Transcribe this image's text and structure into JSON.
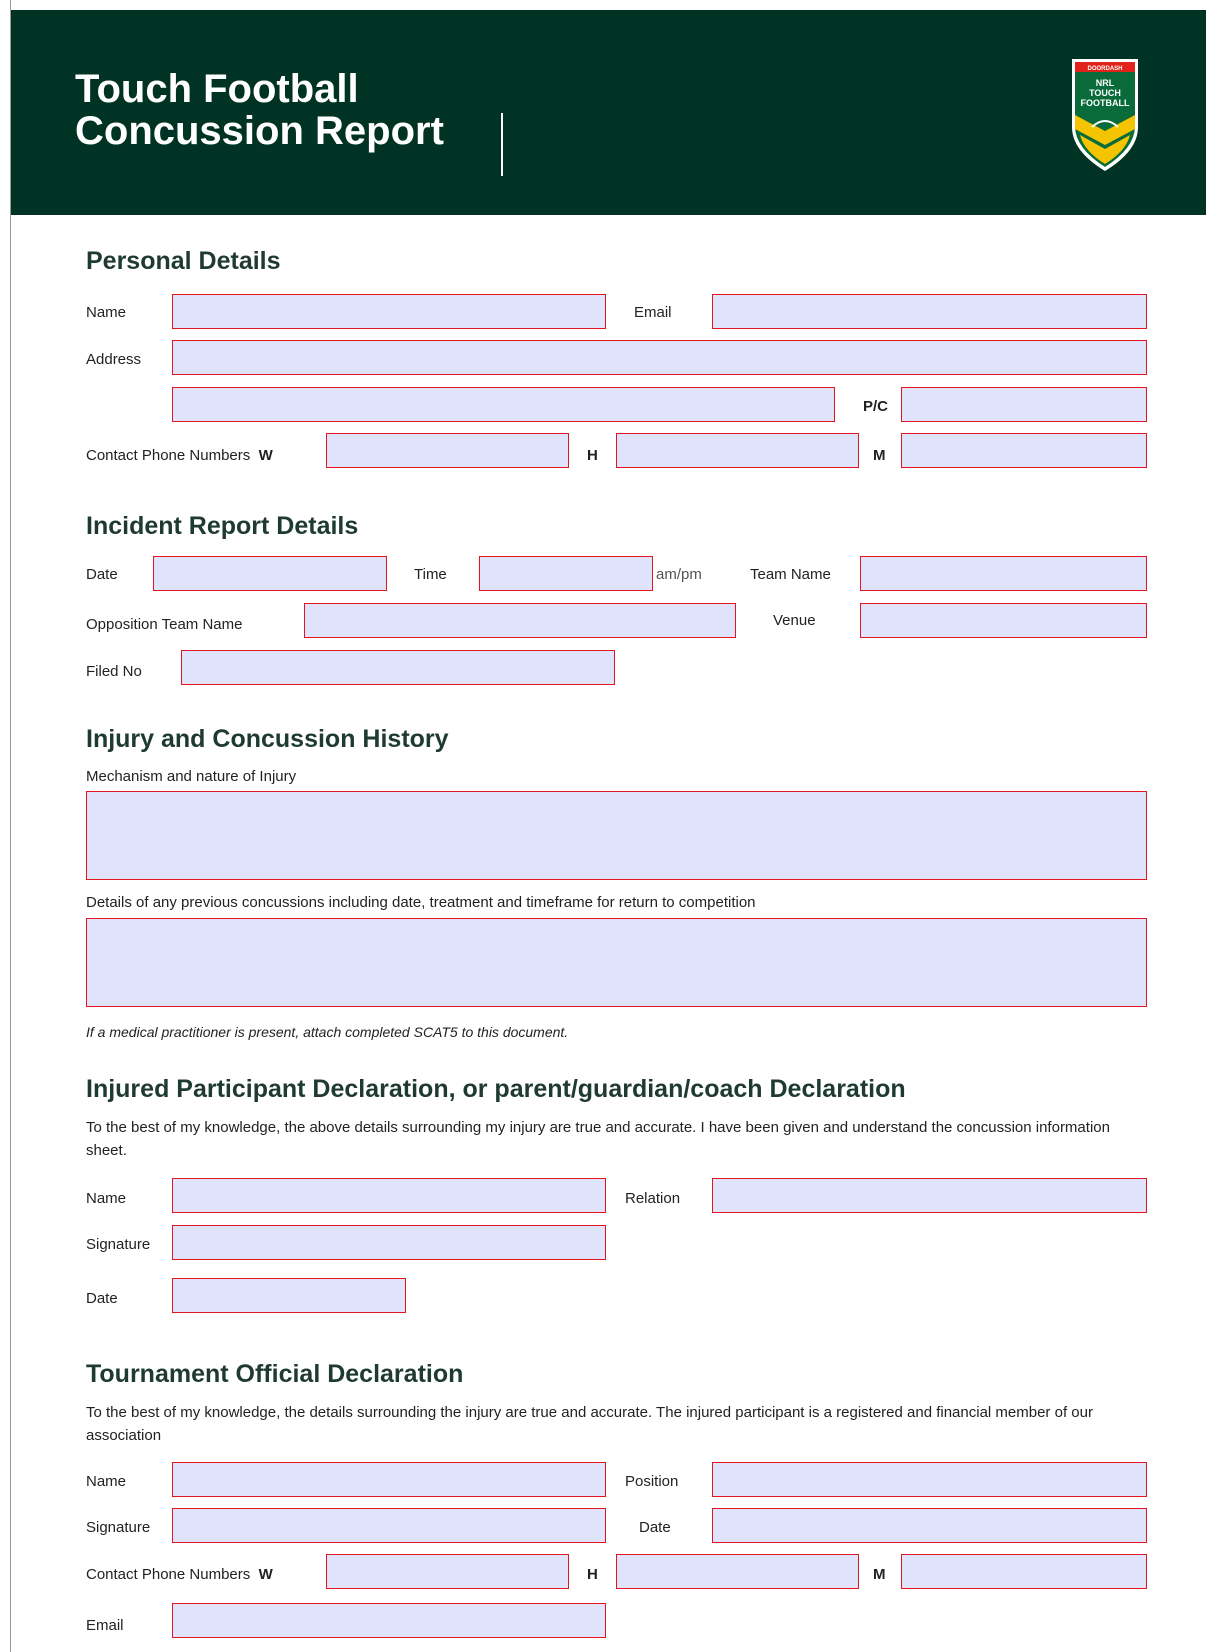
{
  "header": {
    "title_line1": "Touch Football",
    "title_line2": "Concussion Report",
    "logo": {
      "icon": "nrl-touch-football-shield-logo",
      "top_text": "DOORDASH",
      "line1": "NRL",
      "line2": "TOUCH",
      "line3": "FOOTBALL"
    }
  },
  "personal": {
    "heading": "Personal Details",
    "name_label": "Name",
    "email_label": "Email",
    "address_label": "Address",
    "pc_label": "P/C",
    "phone_label": "Contact Phone Numbers",
    "w_label": "W",
    "h_label": "H",
    "m_label": "M",
    "values": {
      "name": "",
      "email": "",
      "address1": "",
      "address2": "",
      "pc": "",
      "phone_w": "",
      "phone_h": "",
      "phone_m": ""
    }
  },
  "incident": {
    "heading": "Incident Report Details",
    "date_label": "Date",
    "time_label": "Time",
    "ampm_label": "am/pm",
    "team_label": "Team Name",
    "opposition_label": "Opposition Team Name",
    "venue_label": "Venue",
    "filed_label": "Filed No",
    "values": {
      "date": "",
      "time": "",
      "team": "",
      "opposition": "",
      "venue": "",
      "filed_no": ""
    }
  },
  "history": {
    "heading": "Injury and Concussion History",
    "mechanism_label": "Mechanism and nature of Injury",
    "previous_label": "Details of any previous concussions including date, treatment and timeframe for return to competition",
    "note": "If a medical practitioner is present, attach completed SCAT5 to this document.",
    "values": {
      "mechanism": "",
      "previous": ""
    }
  },
  "participant": {
    "heading": "Injured Participant Declaration, or parent/guardian/coach Declaration",
    "statement": "To the best of my knowledge, the above details surrounding my injury are true and accurate. I have been given and understand the concussion information sheet.",
    "name_label": "Name",
    "relation_label": "Relation",
    "signature_label": "Signature",
    "date_label": "Date",
    "values": {
      "name": "",
      "relation": "",
      "signature": "",
      "date": ""
    }
  },
  "official": {
    "heading": "Tournament Official Declaration",
    "statement": "To the best of my knowledge, the details surrounding the injury are true and accurate. The injured participant is a registered and financial member of our association",
    "name_label": "Name",
    "position_label": "Position",
    "signature_label": "Signature",
    "date_label": "Date",
    "phone_label": "Contact Phone Numbers",
    "w_label": "W",
    "h_label": "H",
    "m_label": "M",
    "email_label": "Email",
    "values": {
      "name": "",
      "position": "",
      "signature": "",
      "date": "",
      "phone_w": "",
      "phone_h": "",
      "phone_m": "",
      "email": ""
    }
  },
  "colors": {
    "header_bg": "#003324",
    "field_bg": "#dfe3fc",
    "field_border": "#e4151d",
    "heading": "#1f3a33"
  }
}
